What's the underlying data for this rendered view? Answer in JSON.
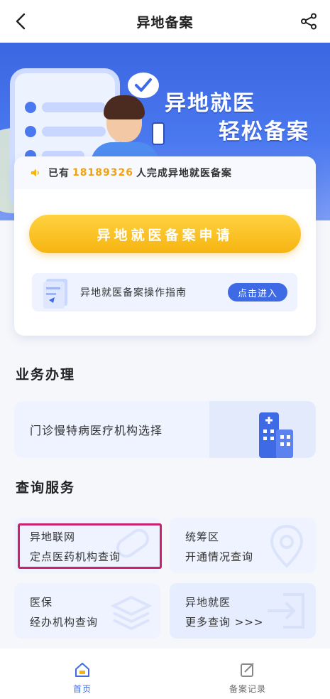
{
  "header": {
    "title": "异地备案"
  },
  "banner": {
    "slogan_line1": "异地就医",
    "slogan_line2": "轻松备案"
  },
  "notice": {
    "prefix": "已有",
    "count": "18189326",
    "suffix": "人完成异地就医备案"
  },
  "apply_button": {
    "label": "异地就医备案申请"
  },
  "guide": {
    "label": "异地就医备案操作指南",
    "button_label": "点击进入"
  },
  "business": {
    "title": "业务办理",
    "items": [
      {
        "label": "门诊慢特病医疗机构选择"
      }
    ]
  },
  "query": {
    "title": "查询服务",
    "items": [
      {
        "line1": "异地联网",
        "line2": "定点医药机构查询"
      },
      {
        "line1": "统筹区",
        "line2": "开通情况查询"
      },
      {
        "line1": "医保",
        "line2": "经办机构查询"
      },
      {
        "line1": "异地就医",
        "line2": "更多查询 >>>"
      }
    ]
  },
  "tabbar": {
    "items": [
      {
        "label": "首页",
        "active": true
      },
      {
        "label": "备案记录",
        "active": false
      }
    ]
  },
  "colors": {
    "primary": "#3f6ae5",
    "accent_yellow": "#f6b411",
    "count_orange": "#f2a10f",
    "highlight": "#c9236f"
  }
}
